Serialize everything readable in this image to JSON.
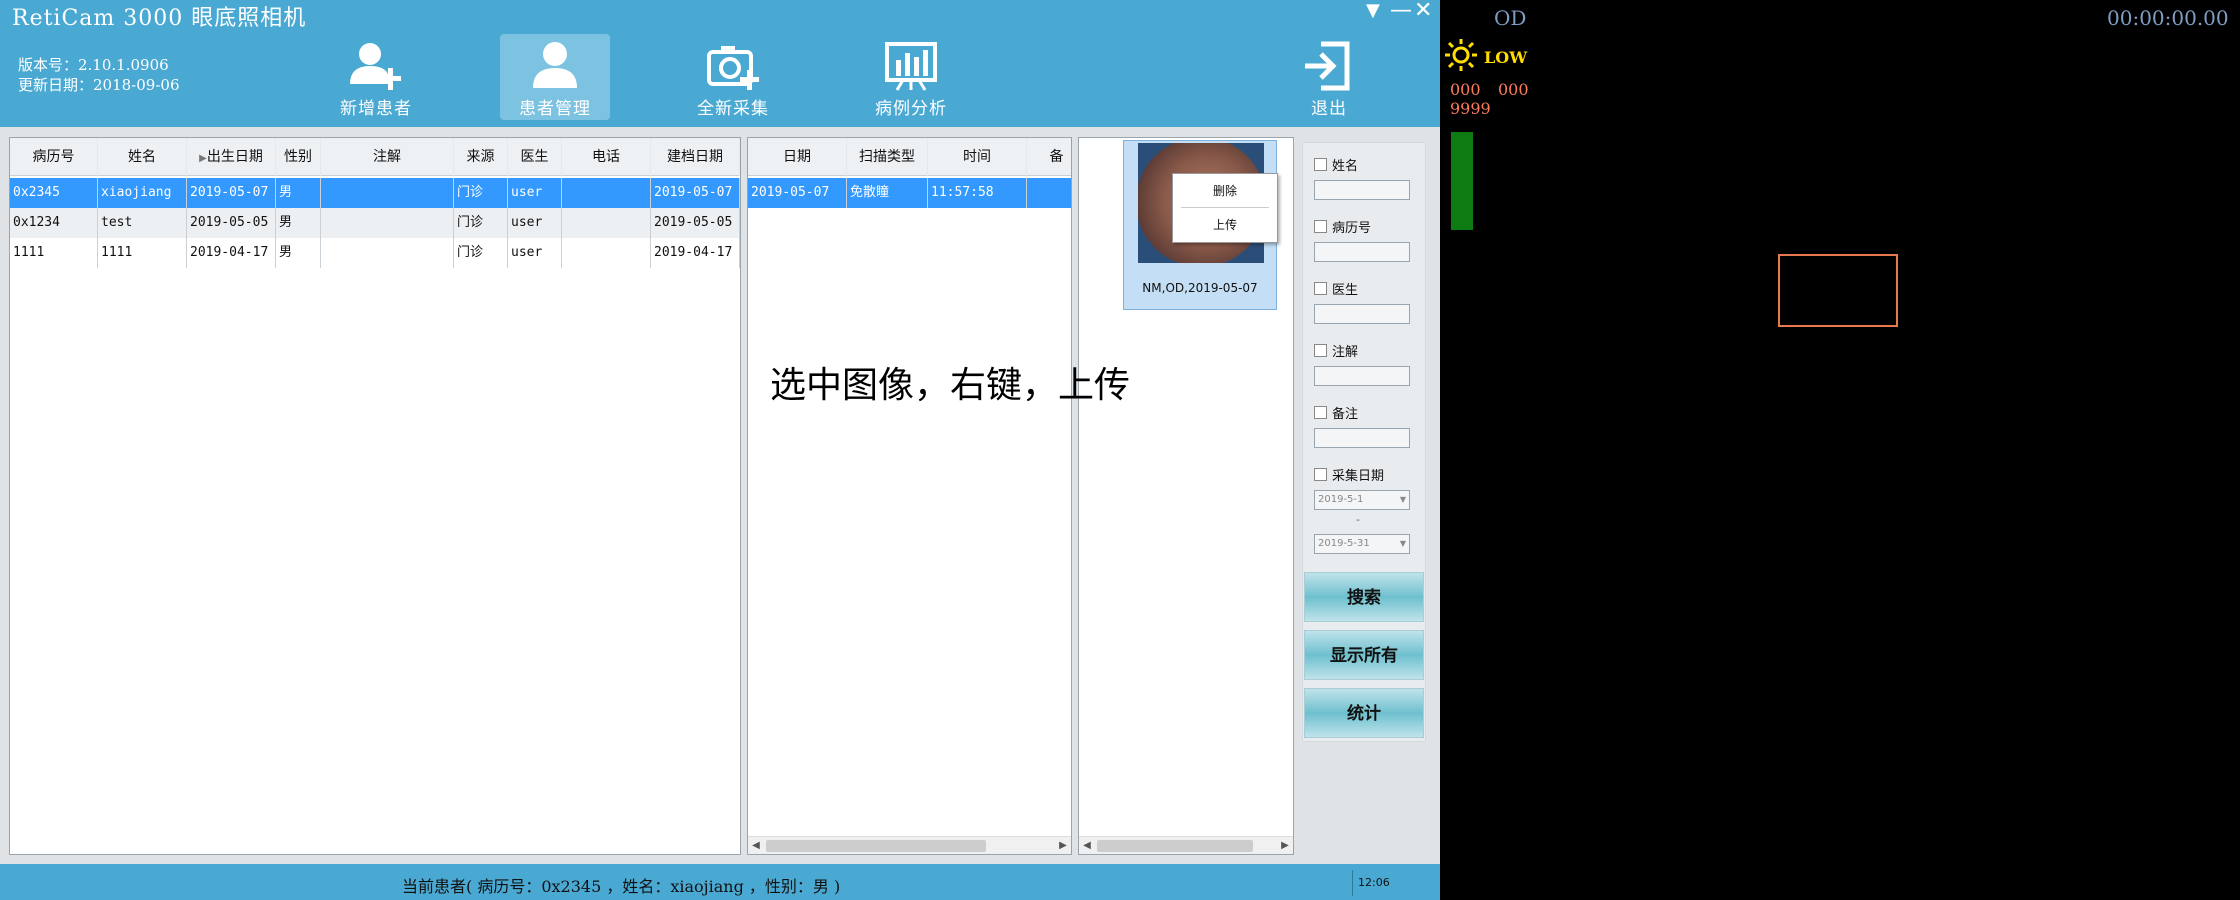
{
  "app": {
    "title": "RetiCam 3000 眼底照相机",
    "version": "版本号：2.10.1.0906",
    "update_date": "更新日期：2018-09-06"
  },
  "window_controls": {
    "dropdown": "▼",
    "minimize": "—",
    "close": "✕"
  },
  "nav": [
    {
      "label": "新增患者",
      "icon": "add-user-icon",
      "active": false
    },
    {
      "label": "患者管理",
      "icon": "user-icon",
      "active": true
    },
    {
      "label": "全新采集",
      "icon": "camera-add-icon",
      "active": false
    },
    {
      "label": "病例分析",
      "icon": "chart-board-icon",
      "active": false
    },
    {
      "label": "退出",
      "icon": "exit-icon",
      "active": false
    }
  ],
  "patients": {
    "columns": [
      "病历号",
      "姓名",
      "出生日期",
      "性别",
      "注解",
      "来源",
      "医生",
      "电话",
      "建档日期"
    ],
    "rows": [
      [
        "0x2345",
        "xiaojiang",
        "2019-05-07",
        "男",
        "",
        "门诊",
        "user",
        "",
        "2019-05-07"
      ],
      [
        "0x1234",
        "test",
        "2019-05-05",
        "男",
        "",
        "门诊",
        "user",
        "",
        "2019-05-05"
      ],
      [
        "1111",
        "1111",
        "2019-04-17",
        "男",
        "",
        "门诊",
        "user",
        "",
        "2019-04-17"
      ]
    ],
    "selected_row": 0
  },
  "exams": {
    "columns": [
      "日期",
      "扫描类型",
      "时间",
      "备"
    ],
    "rows": [
      [
        "2019-05-07",
        "免散瞳",
        "11:57:58",
        ""
      ]
    ]
  },
  "thumbnail": {
    "caption": "NM,OD,2019-05-07"
  },
  "context_menu": {
    "items": [
      "删除",
      "上传"
    ]
  },
  "annotation": "选中图像，右键，上传",
  "search": {
    "fields": [
      "姓名",
      "病历号",
      "医生",
      "注解",
      "备注"
    ],
    "date_label": "采集日期",
    "date_from": "2019-5-1",
    "date_to": "2019-5-31",
    "separator": "-",
    "buttons": [
      "搜索",
      "显示所有",
      "统计"
    ]
  },
  "status": {
    "current_patient": "当前患者( 病历号：0x2345 ，姓名：xiaojiang ，性别：男 )",
    "time": "12:06"
  },
  "right": {
    "eye": "OD",
    "timer": "00:00:00.00",
    "brightness": "LOW",
    "readout1": "000",
    "readout2": "000",
    "readout3": "9999",
    "level_fraction": 0.98,
    "colors": {
      "sun": "#ffdd00",
      "readout": "#ff7b5c",
      "level": "#0d7a12",
      "roi": "#e8794e"
    }
  }
}
